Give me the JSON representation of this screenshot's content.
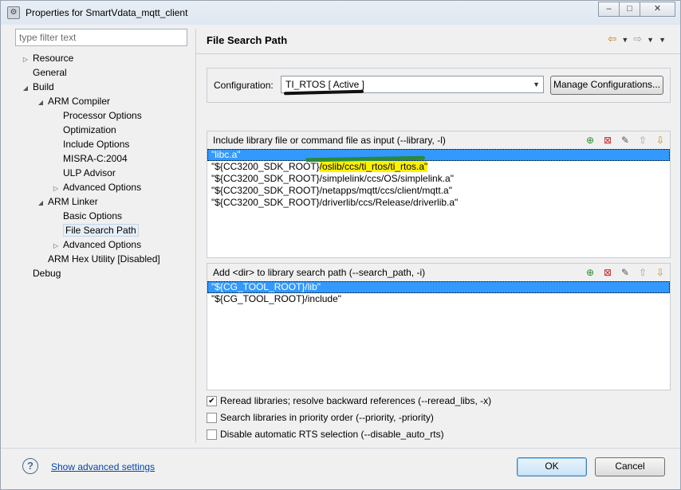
{
  "window": {
    "title": "Properties for SmartVdata_mqtt_client",
    "buttons": {
      "minimize": "–",
      "maximize": "□",
      "close": "✕"
    }
  },
  "sidebar": {
    "filter_placeholder": "type filter text",
    "tree": [
      {
        "label": "Resource",
        "level": 0,
        "expander": "▷"
      },
      {
        "label": "General",
        "level": 0,
        "expander": ""
      },
      {
        "label": "Build",
        "level": 0,
        "expander": "◢"
      },
      {
        "label": "ARM Compiler",
        "level": 1,
        "expander": "◢"
      },
      {
        "label": "Processor Options",
        "level": 2,
        "expander": ""
      },
      {
        "label": "Optimization",
        "level": 2,
        "expander": ""
      },
      {
        "label": "Include Options",
        "level": 2,
        "expander": ""
      },
      {
        "label": "MISRA-C:2004",
        "level": 2,
        "expander": ""
      },
      {
        "label": "ULP Advisor",
        "level": 2,
        "expander": ""
      },
      {
        "label": "Advanced Options",
        "level": 2,
        "expander": "▷"
      },
      {
        "label": "ARM Linker",
        "level": 1,
        "expander": "◢"
      },
      {
        "label": "Basic Options",
        "level": 2,
        "expander": ""
      },
      {
        "label": "File Search Path",
        "level": 2,
        "expander": "",
        "selected": true
      },
      {
        "label": "Advanced Options",
        "level": 2,
        "expander": "▷"
      },
      {
        "label": "ARM Hex Utility  [Disabled]",
        "level": 1,
        "expander": ""
      },
      {
        "label": "Debug",
        "level": 0,
        "expander": ""
      }
    ]
  },
  "main": {
    "title": "File Search Path",
    "configuration_label": "Configuration:",
    "configuration_value": "TI_RTOS  [ Active ]",
    "manage_button": "Manage Configurations...",
    "library_group": {
      "title": "Include library file or command file as input (--library, -l)",
      "items": [
        {
          "pre": "\"libc.a\"",
          "hl": "",
          "post": "",
          "selected": true
        },
        {
          "pre": "\"${CC3200_SDK_ROOT}",
          "hl": "/oslib/ccs/ti_rtos/ti_rtos.a\"",
          "post": "",
          "selected": false
        },
        {
          "pre": "\"${CC3200_SDK_ROOT}/simplelink/ccs/OS/simplelink.a\"",
          "hl": "",
          "post": "",
          "selected": false
        },
        {
          "pre": "\"${CC3200_SDK_ROOT}/netapps/mqtt/ccs/client/mqtt.a\"",
          "hl": "",
          "post": "",
          "selected": false
        },
        {
          "pre": "\"${CC3200_SDK_ROOT}/driverlib/ccs/Release/driverlib.a\"",
          "hl": "",
          "post": "",
          "selected": false
        }
      ]
    },
    "search_group": {
      "title": "Add <dir> to library search path (--search_path, -i)",
      "items": [
        {
          "pre": "\"${CG_TOOL_ROOT}/lib\"",
          "hl": "",
          "post": "",
          "selected": true
        },
        {
          "pre": "\"${CG_TOOL_ROOT}/include\"",
          "hl": "",
          "post": "",
          "selected": false
        }
      ]
    },
    "checkboxes": [
      {
        "label": "Reread libraries; resolve backward references (--reread_libs, -x)",
        "checked": true
      },
      {
        "label": "Search libraries in priority order (--priority, -priority)",
        "checked": false
      },
      {
        "label": "Disable automatic RTS selection (--disable_auto_rts)",
        "checked": false
      }
    ]
  },
  "footer": {
    "help_symbol": "?",
    "advanced_link": "Show advanced settings",
    "ok": "OK",
    "cancel": "Cancel"
  },
  "colors": {
    "selection": "#3399ff",
    "highlight": "#fff200",
    "link": "#0645ad"
  }
}
